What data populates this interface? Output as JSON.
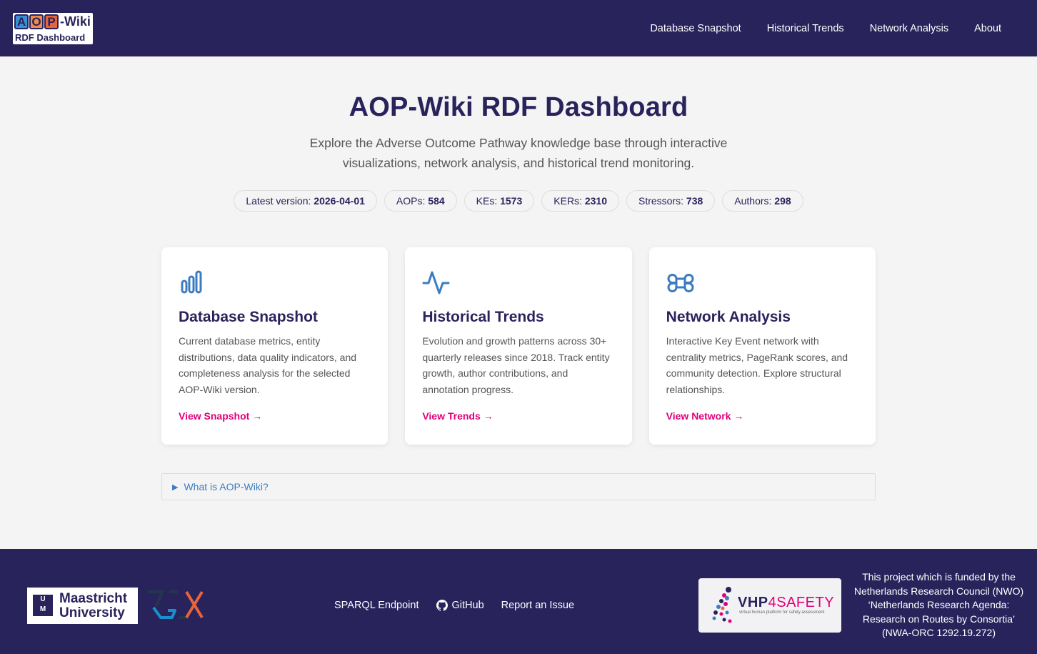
{
  "header": {
    "logo": {
      "letters": [
        "A",
        "O",
        "P"
      ],
      "wiki": "-Wiki",
      "subtitle": "RDF Dashboard"
    },
    "nav": [
      "Database Snapshot",
      "Historical Trends",
      "Network Analysis",
      "About"
    ]
  },
  "hero": {
    "title": "AOP-Wiki RDF Dashboard",
    "description": "Explore the Adverse Outcome Pathway knowledge base through interactive visualizations, network analysis, and historical trend monitoring."
  },
  "stats": [
    {
      "label": "Latest version:",
      "value": "2026-04-01"
    },
    {
      "label": "AOPs:",
      "value": "584"
    },
    {
      "label": "KEs:",
      "value": "1573"
    },
    {
      "label": "KERs:",
      "value": "2310"
    },
    {
      "label": "Stressors:",
      "value": "738"
    },
    {
      "label": "Authors:",
      "value": "298"
    }
  ],
  "cards": [
    {
      "icon": "bar-chart-icon",
      "title": "Database Snapshot",
      "description": "Current database metrics, entity distributions, data quality indicators, and completeness analysis for the selected AOP-Wiki version.",
      "link": "View Snapshot →"
    },
    {
      "icon": "activity-icon",
      "title": "Historical Trends",
      "description": "Evolution and growth patterns across 30+ quarterly releases since 2018. Track entity growth, author contributions, and annotation progress.",
      "link": "View Trends →"
    },
    {
      "icon": "network-icon",
      "title": "Network Analysis",
      "description": "Interactive Key Event network with centrality metrics, PageRank scores, and community detection. Explore structural relationships.",
      "link": "View Network →"
    }
  ],
  "details": {
    "summary": "What is AOP-Wiki?"
  },
  "footer": {
    "um_logo": "Maastricht University",
    "links": [
      "SPARQL Endpoint",
      "GitHub",
      "Report an Issue"
    ],
    "vhp_logo": {
      "bold": "VHP",
      "rest": "4SAFETY",
      "tagline": "virtual human platform for safety assessment"
    },
    "funding": "This project which is funded by the Netherlands Research Council (NWO) ‘Netherlands Research Agenda: Research on Routes by Consortia’ (NWA-ORC 1292.19.272)"
  },
  "colors": {
    "primary": "#29235c",
    "accent": "#e1007a",
    "icon": "#3b7cc1"
  }
}
